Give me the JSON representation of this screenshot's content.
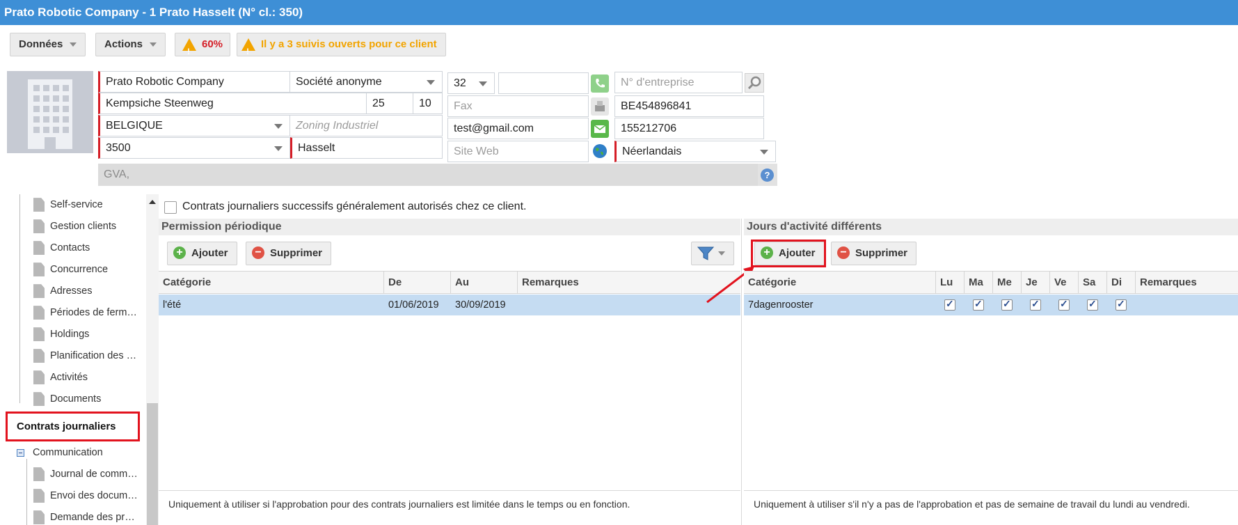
{
  "title": "Prato Robotic Company - 1 Prato Hasselt (N° cl.: 350)",
  "toolbar": {
    "data_label": "Données",
    "actions_label": "Actions",
    "percent": "60%",
    "followups_warning": "Il y a 3 suivis ouverts pour ce client"
  },
  "company": {
    "name": "Prato Robotic Company",
    "legal_form": "Société anonyme",
    "street": "Kempsiche Steenweg",
    "number": "25",
    "box": "10",
    "country": "BELGIQUE",
    "zone_placeholder": "Zoning Industriel",
    "postcode": "3500",
    "city": "Hasselt",
    "phone_prefix": "32",
    "phone": "",
    "fax_placeholder": "Fax",
    "email": "test@gmail.com",
    "website_placeholder": "Site Web",
    "enterprise_placeholder": "N° d'entreprise",
    "vat": "BE454896841",
    "number2": "155212706",
    "language": "Néerlandais",
    "gva": "GVA,"
  },
  "sidebar": {
    "items": [
      "Self-service",
      "Gestion clients",
      "Contacts",
      "Concurrence",
      "Adresses",
      "Périodes de ferm…",
      "Holdings",
      "Planification des …",
      "Activités",
      "Documents"
    ],
    "active": "Contrats journaliers",
    "section": "Communication",
    "sub_items": [
      "Journal de comm…",
      "Envoi des docum…",
      "Demande des pr…"
    ]
  },
  "checkbox_label": "Contrats journaliers successifs généralement autorisés chez ce client.",
  "left_panel": {
    "title": "Permission périodique",
    "add_label": "Ajouter",
    "delete_label": "Supprimer",
    "columns": [
      "Catégorie",
      "De",
      "Au",
      "Remarques"
    ],
    "rows": [
      {
        "category": "l'été",
        "from": "01/06/2019",
        "to": "30/09/2019",
        "remarks": ""
      }
    ],
    "footer": "Uniquement à utiliser si l'approbation pour des contrats journaliers est limitée dans le temps ou en fonction."
  },
  "right_panel": {
    "title": "Jours d'activité différents",
    "add_label": "Ajouter",
    "delete_label": "Supprimer",
    "columns": [
      "Catégorie",
      "Lu",
      "Ma",
      "Me",
      "Je",
      "Ve",
      "Sa",
      "Di",
      "Remarques"
    ],
    "rows": [
      {
        "category": "7dagenrooster",
        "days": [
          true,
          true,
          true,
          true,
          true,
          true,
          true
        ],
        "remarks": ""
      }
    ],
    "footer": "Uniquement à utiliser s'il n'y a pas de l'approbation et pas de semaine de travail du lundi au vendredi."
  },
  "colors": {
    "title_bar": "#3e8fd6",
    "highlight_red": "#e2131e",
    "selected_row": "#c5dcf2",
    "warning": "#f2a400"
  }
}
